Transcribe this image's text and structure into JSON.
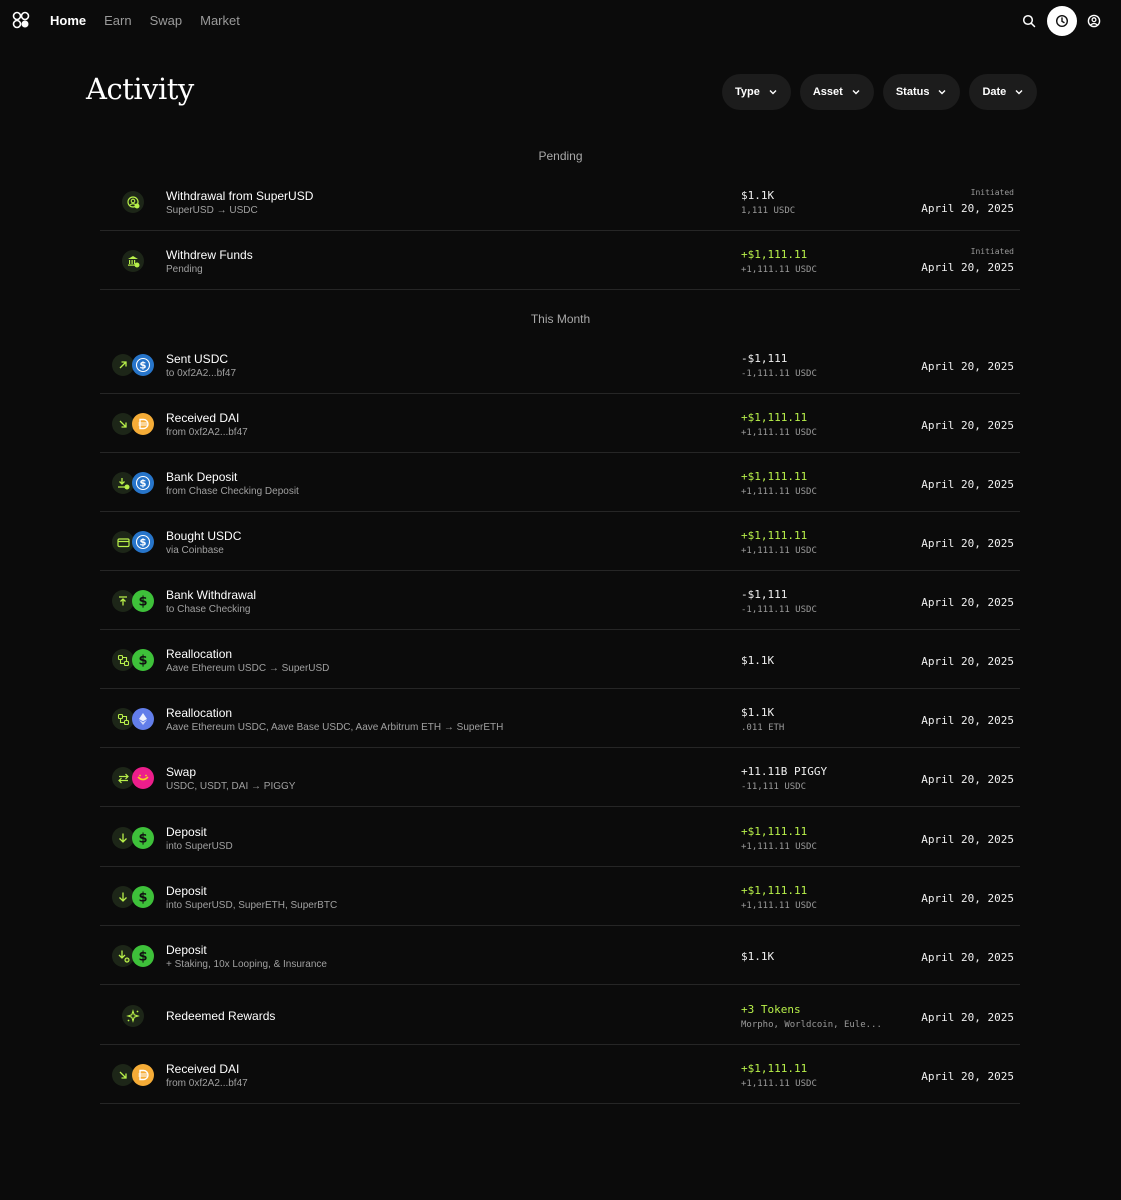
{
  "nav": {
    "links": [
      "Home",
      "Earn",
      "Swap",
      "Market"
    ],
    "active": "Home"
  },
  "page": {
    "title": "Activity",
    "filters": [
      "Type",
      "Asset",
      "Status",
      "Date"
    ]
  },
  "sections": {
    "pending": "Pending",
    "this_month": "This Month"
  },
  "colors": {
    "accent_green": "#b8f04a",
    "usdc_blue": "#2775ca",
    "dai_yellow": "#f5ac37",
    "dollar_green": "#3ec13a",
    "eth_purple": "#627eea",
    "piggy_pink": "#ec1e8b"
  },
  "pending": [
    {
      "title": "Withdrawal from SuperUSD",
      "subtitle": "SuperUSD → USDC",
      "amount": "$1.1K",
      "amount_sub": "1,111 USDC",
      "status": "Initiated",
      "date": "April 20, 2025",
      "icons": [
        "person-icon"
      ]
    },
    {
      "title": "Withdrew Funds",
      "subtitle": "Pending",
      "amount": "+$1,111.11",
      "amount_sub": "+1,111.11 USDC",
      "status": "Initiated",
      "date": "April 20, 2025",
      "icons": [
        "bank-icon"
      ]
    }
  ],
  "this_month": [
    {
      "title": "Sent USDC",
      "subtitle": "to 0xf2A2...bf47",
      "amount": "-$1,111",
      "amount_sub": "-1,111.11 USDC",
      "date": "April 20, 2025",
      "icons": [
        "arrow-up-right-icon",
        "usdc-icon"
      ]
    },
    {
      "title": "Received DAI",
      "subtitle": "from 0xf2A2...bf47",
      "amount": "+$1,111.11",
      "amount_sub": "+1,111.11 USDC",
      "date": "April 20, 2025",
      "icons": [
        "arrow-down-right-icon",
        "dai-icon"
      ]
    },
    {
      "title": "Bank Deposit",
      "subtitle": "from Chase Checking Deposit",
      "amount": "+$1,111.11",
      "amount_sub": "+1,111.11 USDC",
      "date": "April 20, 2025",
      "icons": [
        "arrow-down-bank-icon",
        "usdc-icon"
      ]
    },
    {
      "title": "Bought USDC",
      "subtitle": "via Coinbase",
      "amount": "+$1,111.11",
      "amount_sub": "+1,111.11 USDC",
      "date": "April 20, 2025",
      "icons": [
        "card-icon",
        "usdc-icon"
      ]
    },
    {
      "title": "Bank Withdrawal",
      "subtitle": "to Chase Checking",
      "amount": "-$1,111",
      "amount_sub": "-1,111.11 USDC",
      "date": "April 20, 2025",
      "icons": [
        "arrow-up-bar-icon",
        "dollar-icon"
      ]
    },
    {
      "title": "Reallocation",
      "subtitle": "Aave Ethereum USDC → SuperUSD",
      "amount": "$1.1K",
      "amount_sub": "",
      "date": "April 20, 2025",
      "icons": [
        "reallocate-icon",
        "dollar-icon"
      ]
    },
    {
      "title": "Reallocation",
      "subtitle": "Aave Ethereum USDC, Aave Base USDC, Aave Arbitrum ETH → SuperETH",
      "amount": "$1.1K",
      "amount_sub": ".011 ETH",
      "date": "April 20, 2025",
      "icons": [
        "reallocate-icon",
        "eth-icon"
      ]
    },
    {
      "title": "Swap",
      "subtitle": "USDC, USDT, DAI → PIGGY",
      "amount": "+11.11B PIGGY",
      "amount_sub": "-11,111 USDC",
      "date": "April 20, 2025",
      "icons": [
        "swap-icon",
        "piggy-icon"
      ]
    },
    {
      "title": "Deposit",
      "subtitle": "into SuperUSD",
      "amount": "+$1,111.11",
      "amount_sub": "+1,111.11 USDC",
      "date": "April 20, 2025",
      "icons": [
        "arrow-down-icon",
        "dollar-icon"
      ]
    },
    {
      "title": "Deposit",
      "subtitle": "into SuperUSD, SuperETH, SuperBTC",
      "amount": "+$1,111.11",
      "amount_sub": "+1,111.11 USDC",
      "date": "April 20, 2025",
      "icons": [
        "arrow-down-icon",
        "dollar-icon"
      ]
    },
    {
      "title": "Deposit",
      "subtitle": "+ Staking, 10x Looping, & Insurance",
      "amount": "$1.1K",
      "amount_sub": "",
      "date": "April 20, 2025",
      "icons": [
        "arrow-down-plus-icon",
        "dollar-icon"
      ]
    },
    {
      "title": "Redeemed Rewards",
      "subtitle": "",
      "amount": "+3 Tokens",
      "amount_sub": "Morpho, Worldcoin, Eule...",
      "date": "April 20, 2025",
      "icons": [
        "sparkle-icon"
      ]
    },
    {
      "title": "Received DAI",
      "subtitle": "from 0xf2A2...bf47",
      "amount": "+$1,111.11",
      "amount_sub": "+1,111.11 USDC",
      "date": "April 20, 2025",
      "icons": [
        "arrow-down-right-icon",
        "dai-icon"
      ]
    }
  ]
}
